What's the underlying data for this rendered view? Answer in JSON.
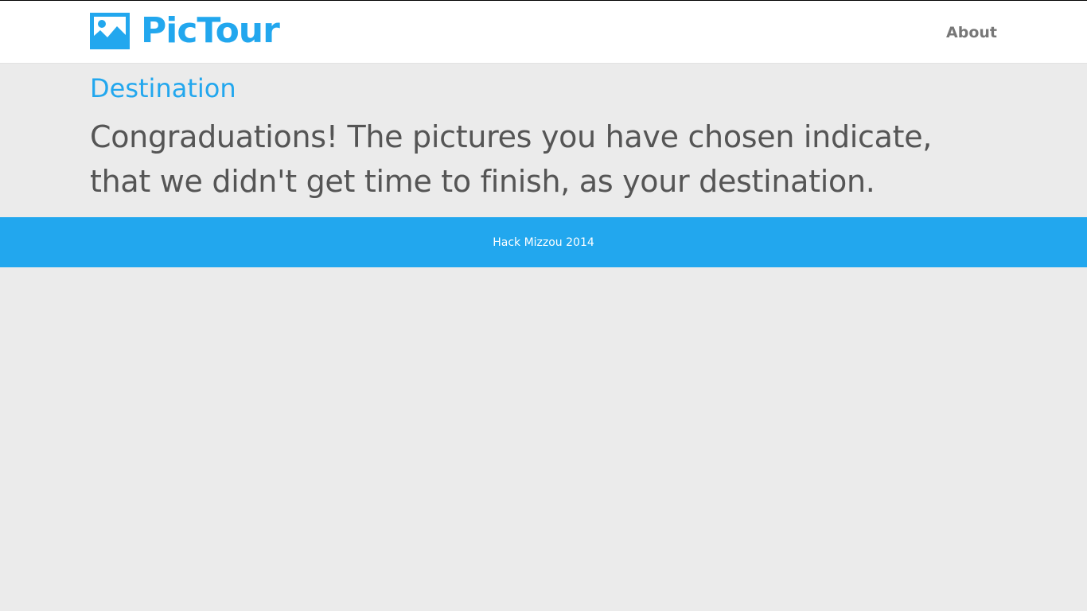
{
  "navbar": {
    "brand_name": "PicTour",
    "brand_icon": "image-icon",
    "about_label": "About"
  },
  "main": {
    "section_title": "Destination",
    "message": "Congraduations! The pictures you have chosen indicate, that we didn't get time to finish, as your destination."
  },
  "footer": {
    "text": "Hack Mizzou 2014"
  },
  "colors": {
    "accent": "#22a7ee",
    "background": "#ebebeb",
    "navbar": "#ffffff",
    "text": "#555555",
    "nav_link": "#777777",
    "footer_text": "#ffffff"
  }
}
